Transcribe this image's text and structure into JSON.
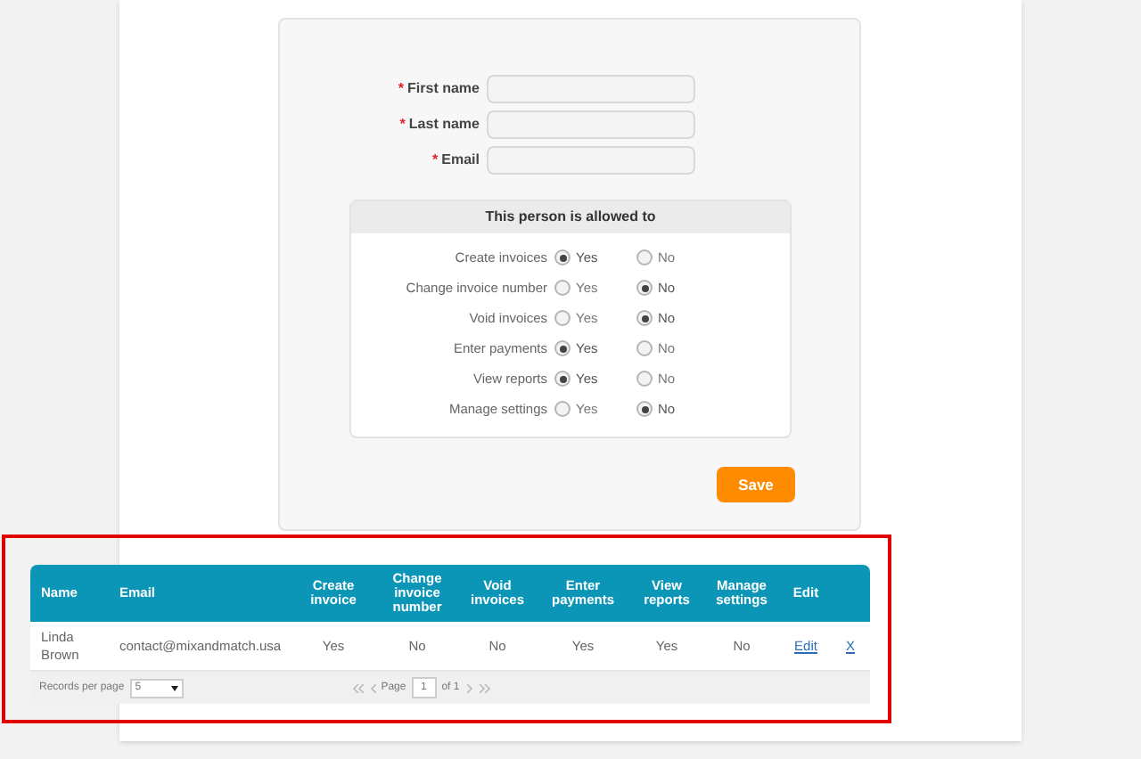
{
  "form": {
    "fields": [
      {
        "label": "First name",
        "required_mark": "*"
      },
      {
        "label": "Last name",
        "required_mark": "*"
      },
      {
        "label": "Email",
        "required_mark": "*"
      }
    ],
    "permissions": {
      "title": "This person is allowed to",
      "rows": [
        {
          "label": "Create invoices",
          "options": [
            {
              "label": "Yes",
              "selected": true
            },
            {
              "label": "No",
              "selected": false
            }
          ]
        },
        {
          "label": "Change invoice number",
          "options": [
            {
              "label": "Yes",
              "selected": false
            },
            {
              "label": "No",
              "selected": true
            }
          ]
        },
        {
          "label": "Void invoices",
          "options": [
            {
              "label": "Yes",
              "selected": false
            },
            {
              "label": "No",
              "selected": true
            }
          ]
        },
        {
          "label": "Enter payments",
          "options": [
            {
              "label": "Yes",
              "selected": true
            },
            {
              "label": "No",
              "selected": false
            }
          ]
        },
        {
          "label": "View reports",
          "options": [
            {
              "label": "Yes",
              "selected": true
            },
            {
              "label": "No",
              "selected": false
            }
          ]
        },
        {
          "label": "Manage settings",
          "options": [
            {
              "label": "Yes",
              "selected": false
            },
            {
              "label": "No",
              "selected": true
            }
          ]
        }
      ]
    },
    "save_button": "Save"
  },
  "table": {
    "columns": [
      "Name",
      "Email",
      "Create invoice",
      "Change invoice number",
      "Void invoices",
      "Enter payments",
      "View reports",
      "Manage settings",
      "Edit"
    ],
    "rows": [
      {
        "cells": [
          "Linda Brown",
          "contact@mixandmatch.usa",
          "Yes",
          "No",
          "No",
          "Yes",
          "Yes",
          "No"
        ],
        "edit": "Edit",
        "delete": "X"
      }
    ],
    "footer": {
      "records_label": "Records per page",
      "records_value": "5",
      "page_label": "Page",
      "page_value": "1",
      "page_total": "of 1"
    }
  }
}
